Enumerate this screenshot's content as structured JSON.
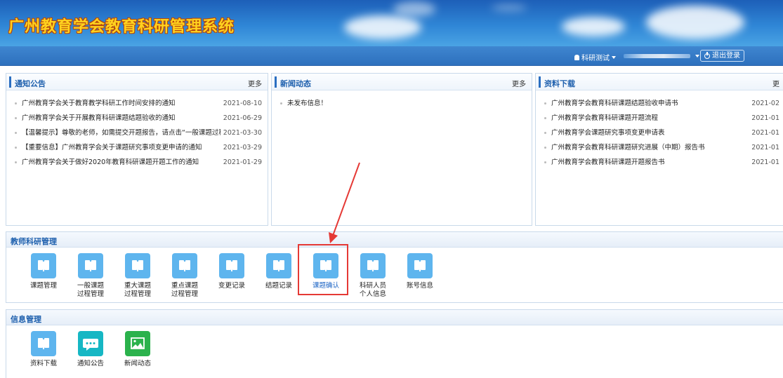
{
  "header": {
    "title": "广州教育学会教育科研管理系统"
  },
  "navbar": {
    "user_label": "科研测试",
    "logout_label": "退出登录"
  },
  "notice": {
    "title": "通知公告",
    "more": "更多",
    "items": [
      {
        "text": "广州教育学会关于教育教学科研工作时间安排的通知",
        "date": "2021-08-10"
      },
      {
        "text": "广州教育学会关于开展教育科研课题结题验收的通知",
        "date": "2021-06-29"
      },
      {
        "text": "【温馨提示】尊敬的老师，如需提交开题报告，请点击“一般课题过程管",
        "date": "2021-03-30"
      },
      {
        "text": "【重要信息】广州教育学会关于课题研究事项变更申请的通知",
        "date": "2021-03-29"
      },
      {
        "text": "广州教育学会关于做好2020年教育科研课题开题工作的通知",
        "date": "2021-01-29"
      }
    ]
  },
  "news": {
    "title": "新闻动态",
    "more": "更多",
    "items": [
      {
        "text": "未发布信息！"
      }
    ]
  },
  "downloads": {
    "title": "资料下载",
    "more": "更",
    "items": [
      {
        "text": "广州教育学会教育科研课题结题验收申请书",
        "date": "2021-02"
      },
      {
        "text": "广州教育学会教育科研课题开题流程",
        "date": "2021-01"
      },
      {
        "text": "广州教育学会课题研究事项变更申请表",
        "date": "2021-01"
      },
      {
        "text": "广州教育学会教育科研课题研究进展（中期）报告书",
        "date": "2021-01"
      },
      {
        "text": "广州教育学会教育科研课题开题报告书",
        "date": "2021-01"
      }
    ]
  },
  "teacher_section": {
    "title": "教师科研管理",
    "tiles": [
      {
        "line1": "课题管理",
        "line2": "",
        "icon": "book-icon"
      },
      {
        "line1": "一般课题",
        "line2": "过程管理",
        "icon": "book-icon"
      },
      {
        "line1": "重大课题",
        "line2": "过程管理",
        "icon": "book-icon"
      },
      {
        "line1": "重点课题",
        "line2": "过程管理",
        "icon": "book-icon"
      },
      {
        "line1": "变更记录",
        "line2": "",
        "icon": "book-icon"
      },
      {
        "line1": "结题记录",
        "line2": "",
        "icon": "book-icon"
      },
      {
        "line1": "课题确认",
        "line2": "",
        "icon": "book-icon"
      },
      {
        "line1": "科研人员",
        "line2": "个人信息",
        "icon": "book-icon"
      },
      {
        "line1": "账号信息",
        "line2": "",
        "icon": "book-icon"
      }
    ]
  },
  "info_section": {
    "title": "信息管理",
    "tiles": [
      {
        "line1": "资料下载",
        "icon": "book-icon",
        "color": "#5eb5ee"
      },
      {
        "line1": "通知公告",
        "icon": "chat-icon",
        "color": "#16b7c4"
      },
      {
        "line1": "新闻动态",
        "icon": "image-icon",
        "color": "#2bb24c"
      }
    ]
  },
  "colors": {
    "accent": "#2b6fc1",
    "title_yellow": "#ffd21f",
    "annotation_red": "#e53935"
  }
}
